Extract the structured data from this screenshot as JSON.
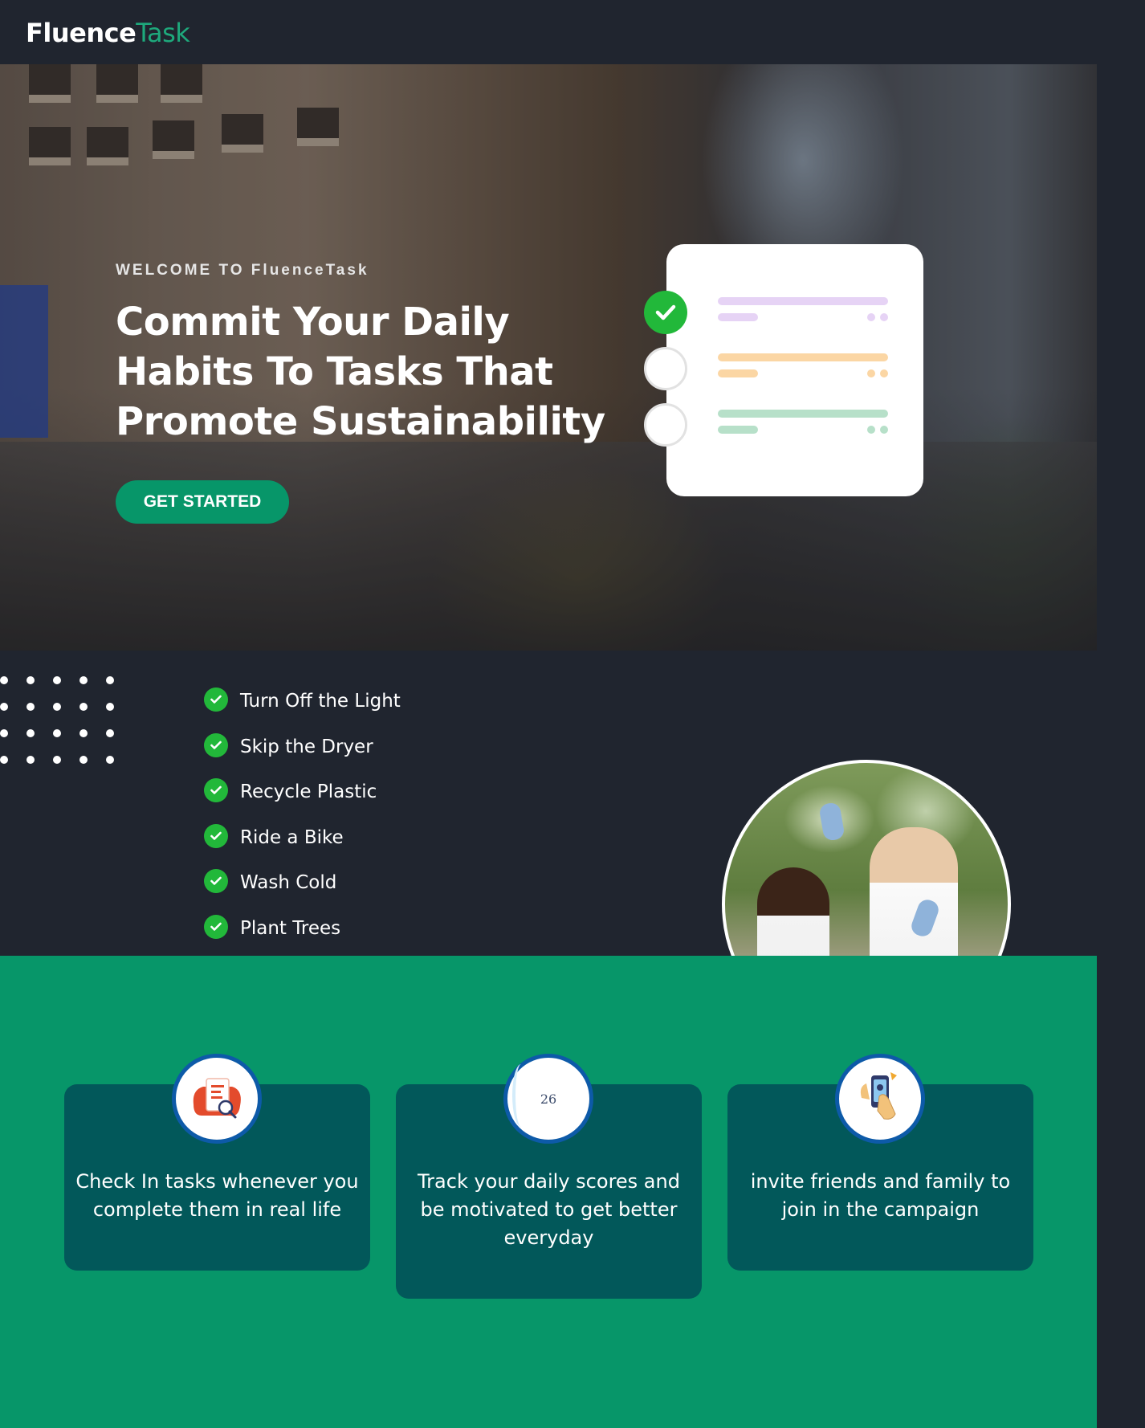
{
  "header": {
    "brand_part1": "Fluence",
    "brand_part2": "Task"
  },
  "hero": {
    "eyebrow": "WELCOME TO FluenceTask",
    "title": "Commit Your Daily Habits To Tasks That Promote Sustainability",
    "cta_label": "GET STARTED"
  },
  "task_card": {
    "rows": [
      {
        "status": "done",
        "color": "#e6d3f5",
        "dot_color": "#e6d3f5"
      },
      {
        "status": "todo",
        "color": "#fbd6a4",
        "dot_color": "#fbd6a4"
      },
      {
        "status": "todo",
        "color": "#b7e0c9",
        "dot_color": "#b7e0c9"
      }
    ]
  },
  "features": {
    "items": [
      "Turn Off the Light",
      "Skip the Dryer",
      "Recycle Plastic",
      "Ride a Bike",
      "Wash Cold",
      "Plant Trees"
    ]
  },
  "cards": [
    {
      "icon": "checklist-clipboard-icon",
      "text": "Check In tasks whenever you complete them in real life"
    },
    {
      "icon": "score-gauge-icon",
      "score": "26",
      "text": "Track your daily scores and be motivated to get better everyday"
    },
    {
      "icon": "phone-invite-icon",
      "text": "invite friends and family to join in the campaign"
    }
  ],
  "colors": {
    "background": "#20252f",
    "accent_green": "#079669",
    "brand_green": "#1ea97c",
    "card_teal": "#02585a",
    "check_green": "#22b83a"
  }
}
